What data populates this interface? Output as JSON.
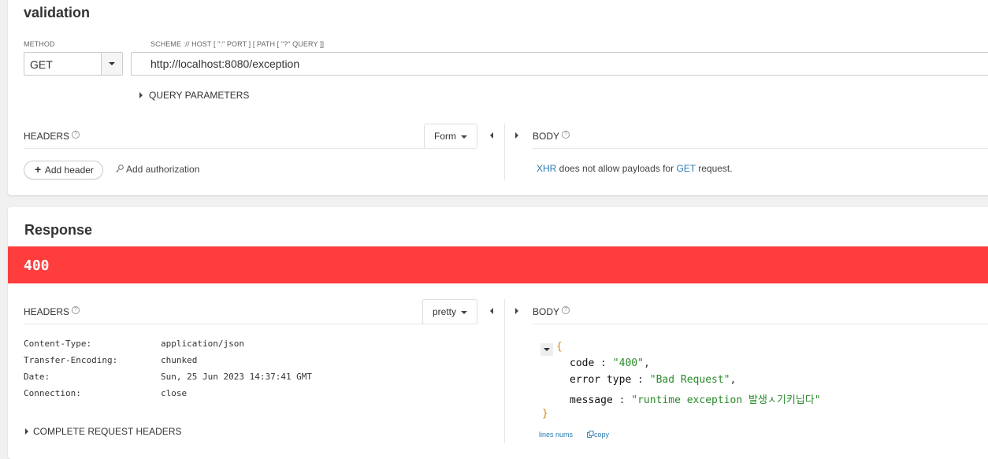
{
  "request": {
    "title": "validation",
    "method_label": "METHOD",
    "url_label": "SCHEME :// HOST [ \":\" PORT ] [ PATH [ \"?\" QUERY ]]",
    "method": "GET",
    "url": "http://localhost:8080/exception",
    "query_params": "QUERY PARAMETERS",
    "headers_label": "HEADERS",
    "form_label": "Form",
    "add_header": "Add header",
    "add_authorization": "Add authorization",
    "body_label": "BODY",
    "body_note": {
      "xhr": "XHR",
      "mid": " does not allow payloads for ",
      "get": "GET",
      "end": " request."
    }
  },
  "response": {
    "title": "Response",
    "status": "400",
    "status_color": "#ff3d3d",
    "headers_label": "HEADERS",
    "pretty_label": "pretty",
    "body_label": "BODY",
    "headers": [
      {
        "name": "Content-Type:",
        "value": "application/json"
      },
      {
        "name": "Transfer-Encoding:",
        "value": "chunked"
      },
      {
        "name": "Date:",
        "value": "Sun, 25 Jun 2023 14:37:41 GMT"
      },
      {
        "name": "Connection:",
        "value": "close"
      }
    ],
    "complete_headers": "COMPLETE REQUEST HEADERS",
    "json": {
      "open": "{",
      "close": "}",
      "rows": [
        {
          "key": "code",
          "value": "\"400\"",
          "trail": ","
        },
        {
          "key": "error type",
          "value": "\"Bad Request\"",
          "trail": ","
        },
        {
          "key": "message",
          "value": "\"runtime exception 발생ㅅ기키닙다\"",
          "trail": ""
        }
      ]
    },
    "lines_nums": "lines nums",
    "copy": "copy"
  }
}
